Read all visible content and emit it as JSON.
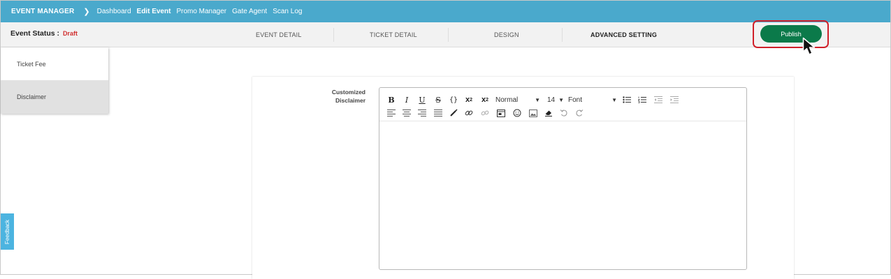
{
  "topnav": {
    "brand": "EVENT MANAGER",
    "links": [
      "Dashboard",
      "Edit Event",
      "Promo Manager",
      "Gate Agent",
      "Scan Log"
    ],
    "active_link": "Edit Event"
  },
  "subheader": {
    "status_label": "Event Status :",
    "status_value": "Draft",
    "tabs": [
      "EVENT DETAIL",
      "TICKET DETAIL",
      "DESIGN",
      "ADVANCED SETTING"
    ],
    "active_tab": "ADVANCED SETTING",
    "publish_label": "Publish"
  },
  "sidebar": {
    "items": [
      "Ticket Fee",
      "Disclaimer"
    ],
    "active_item": "Disclaimer"
  },
  "form": {
    "label_line1": "Customized",
    "label_line2": "Disclaimer",
    "editor": {
      "format_value": "Normal",
      "size_value": "14",
      "font_value": "Font",
      "content": ""
    }
  },
  "feedback_label": "Feedback",
  "colors": {
    "topbar": "#4aa9cc",
    "publish": "#0b7a4a",
    "draft": "#d13030",
    "highlight": "#d0202a",
    "feedback": "#4cb4e0"
  }
}
